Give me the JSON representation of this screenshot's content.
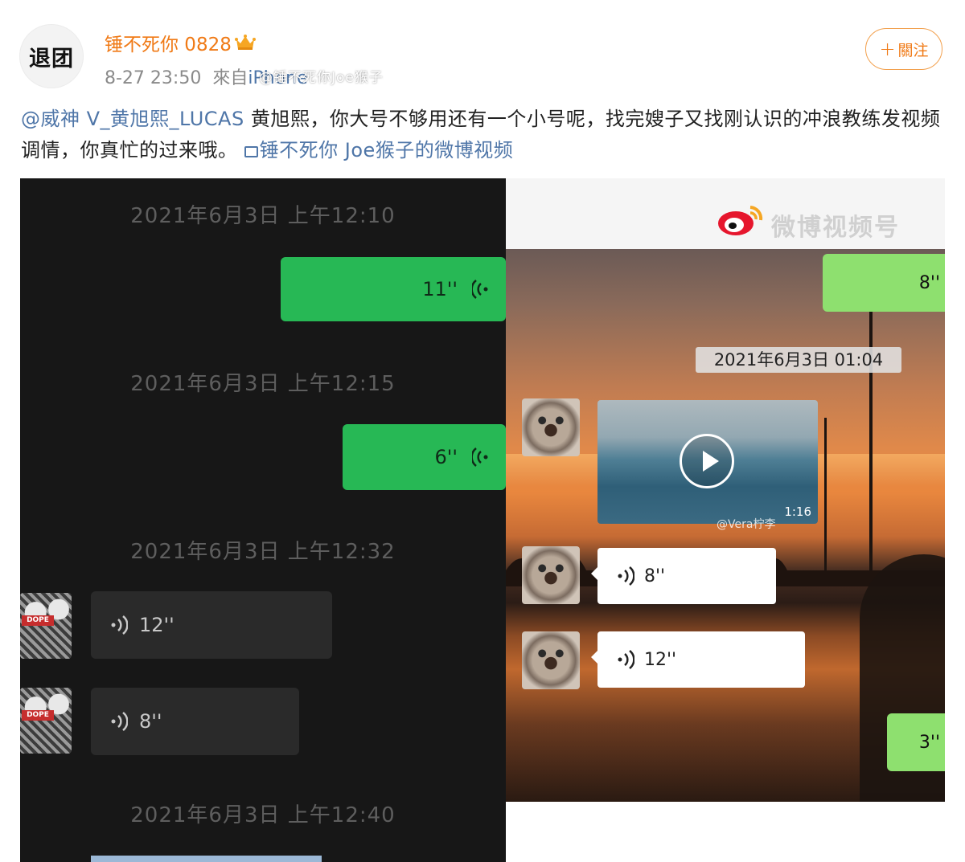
{
  "header": {
    "avatar_text": "退团",
    "username": "锤不死你 0828",
    "time": "8-27 23:50",
    "source_prefix": "來自",
    "device": "iPhone",
    "follow_label": "關注"
  },
  "post": {
    "mention": "@威神 V_黄旭熙_LUCAS",
    "text": " 黄旭熙，你大号不够用还有一个小号呢，找完嫂子又找刚认识的冲浪教练发视频调情，你真忙的过来哦。",
    "video_link": "锤不死你 Joe猴子的微博视频"
  },
  "left_chat": {
    "timestamps": [
      "2021年6月3日 上午12:10",
      "2021年6月3日 上午12:15",
      "2021年6月3日 上午12:32",
      "2021年6月3日 上午12:40"
    ],
    "voice_sent": [
      "11''",
      "6''"
    ],
    "voice_received": [
      "12''",
      "8''"
    ],
    "avatar_badge": "DOPE"
  },
  "right_chat": {
    "brand": "微博视频号",
    "handle": "@锤不死你Joe猴子",
    "timestamp": "2021年6月3日 01:04",
    "sent_top": "8''",
    "sent_bottom": "3''",
    "video_duration": "1:16",
    "video_watermark": "@Vera柠李",
    "voice_received": [
      "8''",
      "12''"
    ]
  },
  "colors": {
    "username": "#f07a16",
    "link": "#4f76a8",
    "wechat_green": "#27b855"
  }
}
